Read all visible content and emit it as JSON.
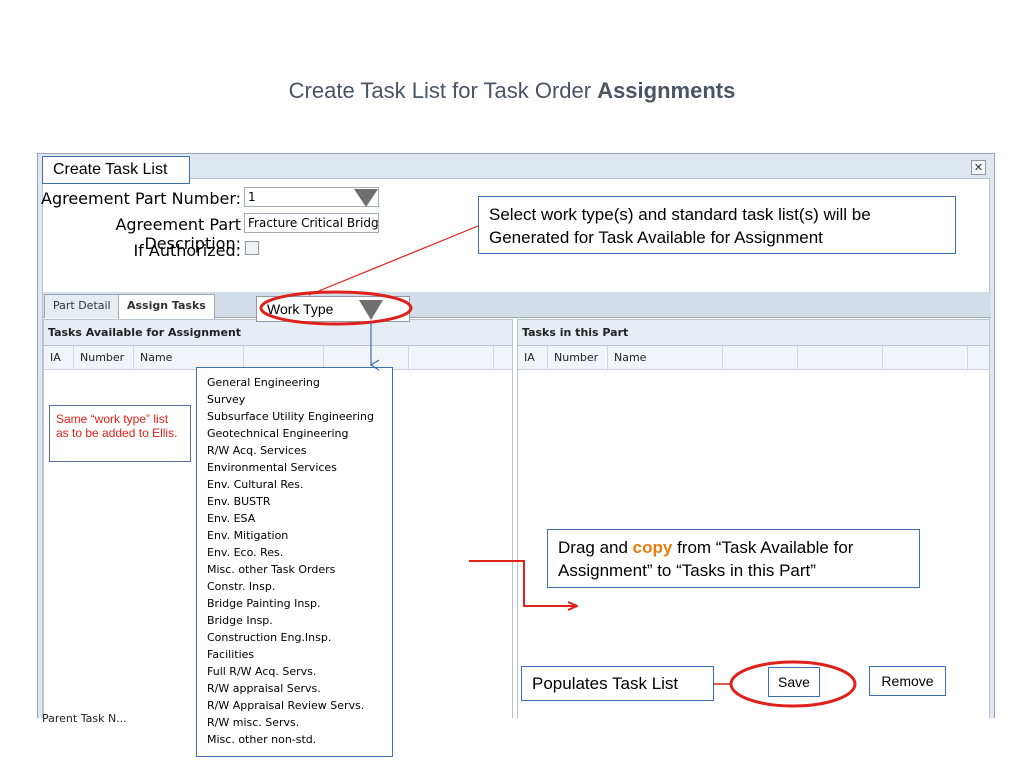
{
  "slide": {
    "title_regular": "Create Task List for Task Order ",
    "title_bold": "Assignments"
  },
  "window": {
    "close_glyph": "✕"
  },
  "form": {
    "agreement_part_number_label": "Agreement Part Number:",
    "agreement_part_number_value": "1",
    "agreement_part_description_label": "Agreement Part Description:",
    "agreement_part_description_value": "Fracture Critical Bridge",
    "if_authorized_label": "If Authorized:"
  },
  "tabs": [
    {
      "label": "Part Detail",
      "active": false
    },
    {
      "label": "Assign Tasks",
      "active": true
    }
  ],
  "left_panel": {
    "title": "Tasks Available for Assignment",
    "columns": [
      "IA",
      "Number",
      "Name"
    ],
    "bottom_label": "Parent Task N..."
  },
  "right_panel": {
    "title": "Tasks in this Part",
    "columns": [
      "IA",
      "Number",
      "Name"
    ]
  },
  "work_type": {
    "label": "Work Type",
    "options": [
      "General Engineering",
      "Survey",
      "Subsurface Utility Engineering",
      "Geotechnical Engineering",
      "R/W Acq. Services",
      "Environmental Services",
      "Env. Cultural Res.",
      "Env. BUSTR",
      "Env. ESA",
      "Env. Mitigation",
      "Env. Eco. Res.",
      "Misc. other Task Orders",
      "Constr. Insp.",
      "Bridge Painting Insp.",
      "Bridge Insp.",
      "Construction  Eng.Insp.",
      "Facilities",
      "Full R/W Acq. Servs.",
      "R/W appraisal Servs.",
      "R/W Appraisal Review Servs.",
      "R/W misc. Servs.",
      "Misc. other non-std."
    ]
  },
  "callouts": {
    "create_task_list": "Create Task List",
    "select_work_type": "Select work type(s) and standard task list(s)  will be Generated for Task Available for Assignment",
    "same_work_type": "Same “work type” list as to be added to Ellis.",
    "drag_before": "Drag and ",
    "drag_copy": "copy",
    "drag_after": " from “Task Available for Assignment” to “Tasks in this Part”",
    "populates_task_list": "Populates Task List"
  },
  "buttons": {
    "save": "Save",
    "remove": "Remove"
  },
  "colors": {
    "callout_border": "#3d6fb6",
    "annotation_red": "#e0201a",
    "copy_orange": "#e87c0c",
    "title_gray": "#4a5462"
  }
}
